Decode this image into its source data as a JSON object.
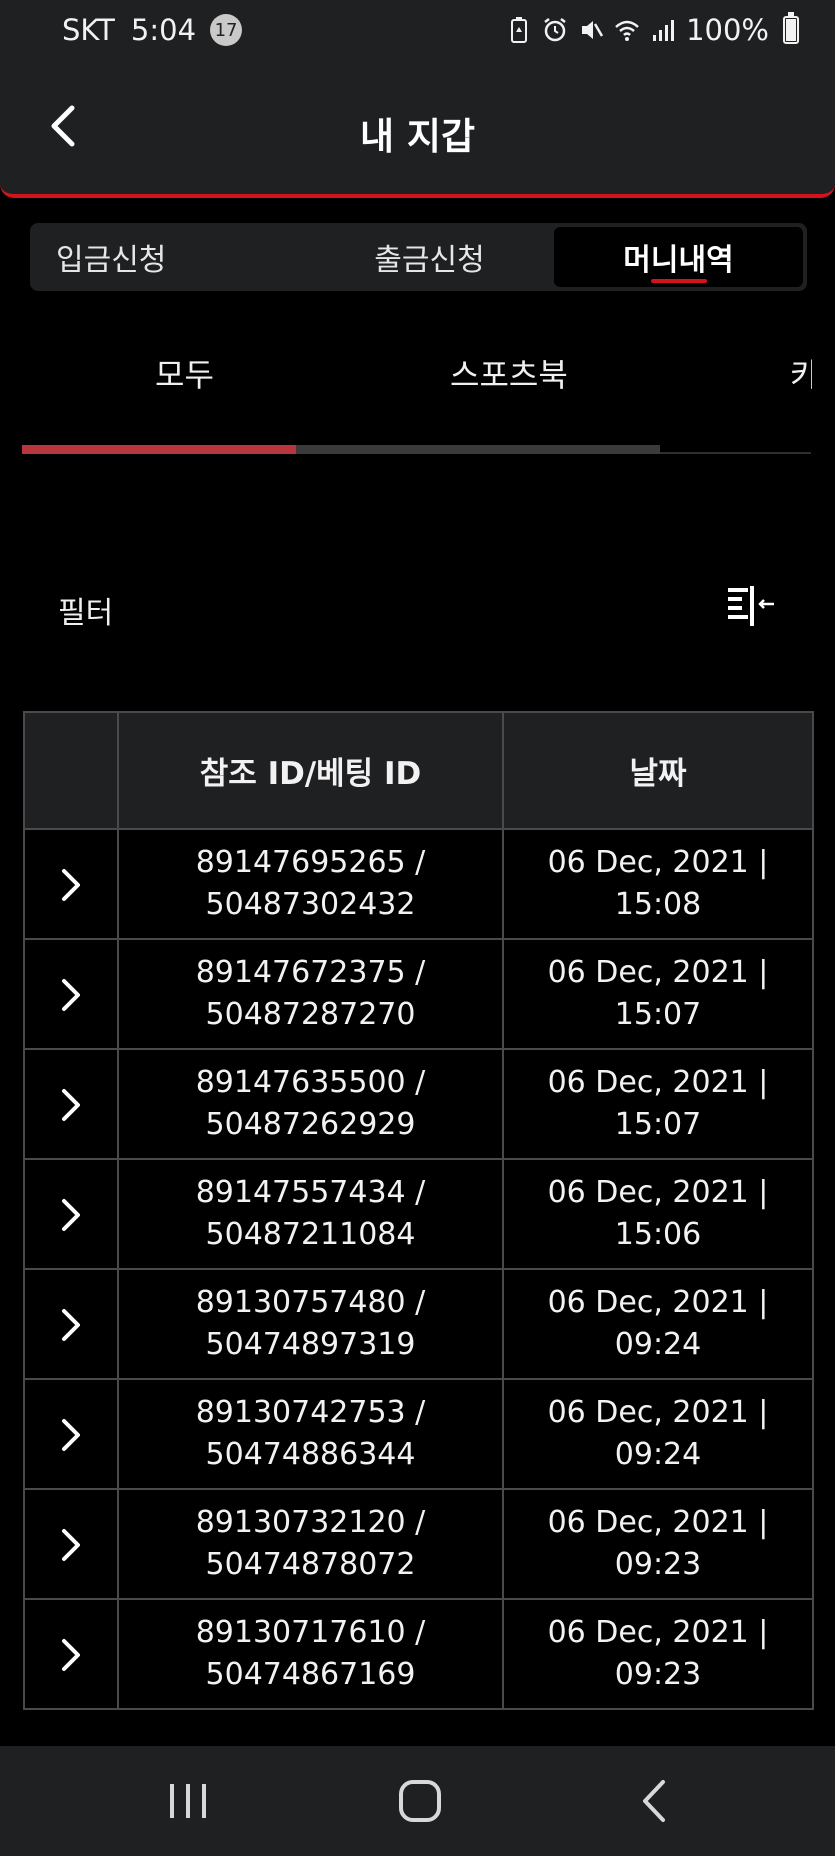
{
  "status_bar": {
    "carrier": "SKT",
    "time": "5:04",
    "notification_count": "17",
    "battery": "100%"
  },
  "header": {
    "title": "내 지갑"
  },
  "segment_tabs": [
    {
      "label": "입금신청",
      "active": false
    },
    {
      "label": "출금신청",
      "active": false
    },
    {
      "label": "머니내역",
      "active": true
    }
  ],
  "sub_tabs": [
    {
      "label": "모두",
      "active": true
    },
    {
      "label": "스포츠북",
      "active": false
    },
    {
      "label": "카",
      "active": false
    }
  ],
  "sub_tab_progress": 0.43,
  "filter": {
    "label": "필터"
  },
  "table": {
    "headers": [
      "",
      "참조 ID/베팅 ID",
      "날짜"
    ],
    "rows": [
      {
        "ref_line1": "89147695265 /",
        "ref_line2": "50487302432",
        "date_line1": "06 Dec, 2021 |",
        "date_line2": "15:08"
      },
      {
        "ref_line1": "89147672375 /",
        "ref_line2": "50487287270",
        "date_line1": "06 Dec, 2021 |",
        "date_line2": "15:07"
      },
      {
        "ref_line1": "89147635500 /",
        "ref_line2": "50487262929",
        "date_line1": "06 Dec, 2021 |",
        "date_line2": "15:07"
      },
      {
        "ref_line1": "89147557434 /",
        "ref_line2": "50487211084",
        "date_line1": "06 Dec, 2021 |",
        "date_line2": "15:06"
      },
      {
        "ref_line1": "89130757480 /",
        "ref_line2": "50474897319",
        "date_line1": "06 Dec, 2021 |",
        "date_line2": "09:24"
      },
      {
        "ref_line1": "89130742753 /",
        "ref_line2": "50474886344",
        "date_line1": "06 Dec, 2021 |",
        "date_line2": "09:24"
      },
      {
        "ref_line1": "89130732120 /",
        "ref_line2": "50474878072",
        "date_line1": "06 Dec, 2021 |",
        "date_line2": "09:23"
      },
      {
        "ref_line1": "89130717610 /",
        "ref_line2": "50474867169",
        "date_line1": "06 Dec, 2021 |",
        "date_line2": "09:23"
      }
    ]
  },
  "colors": {
    "accent": "#d3121b",
    "progress_fill": "#b8363c",
    "surface": "#1f2022",
    "background": "#000000"
  }
}
